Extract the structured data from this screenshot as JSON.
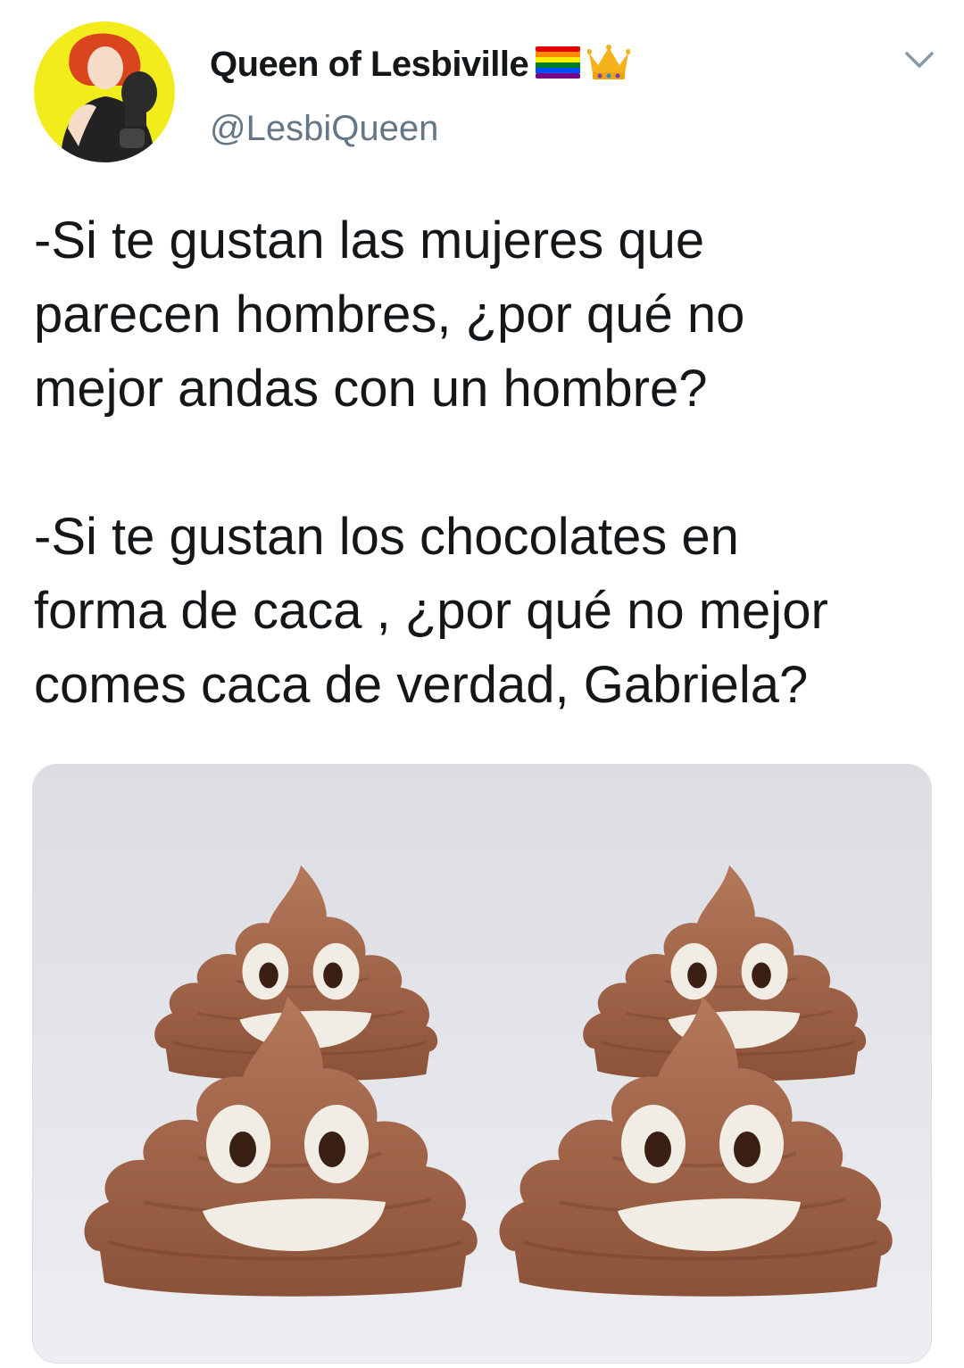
{
  "tweet": {
    "author": {
      "display_name": "Queen of Lesbiville",
      "handle": "@LesbiQueen",
      "badges": [
        "rainbow-flag-icon",
        "crown-icon"
      ]
    },
    "text_paragraphs": [
      "-Si te gustan las mujeres que\nparecen hombres, ¿por qué no\nmejor andas con un hombre?",
      "-Si te gustan los chocolates en\nforma de caca , ¿por qué no mejor\ncomes caca de verdad, Gabriela?"
    ],
    "media": {
      "subject": "four chocolate poop-emoji candies"
    }
  },
  "colors": {
    "text": "#14171a",
    "secondary_text": "#657786",
    "chocolate": "#a66a4a",
    "avatar_background": "#f5ee1f"
  }
}
